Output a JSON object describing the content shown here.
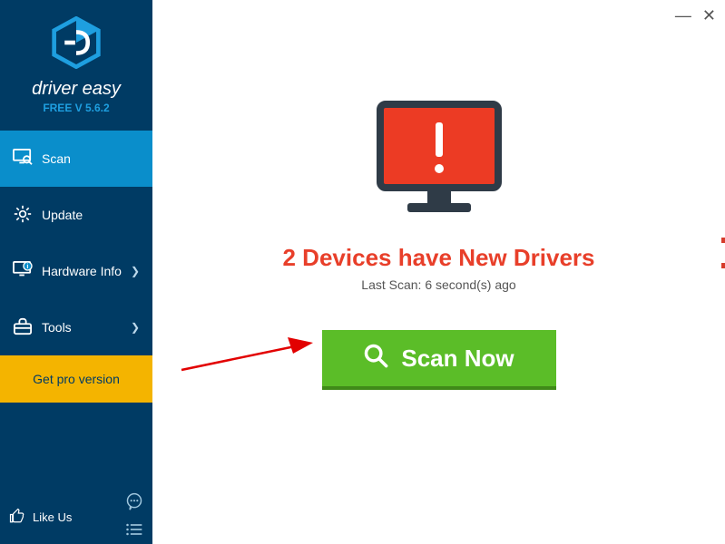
{
  "brand": {
    "name": "driver easy",
    "version": "FREE V 5.6.2"
  },
  "sidebar": {
    "items": [
      {
        "label": "Scan"
      },
      {
        "label": "Update"
      },
      {
        "label": "Hardware Info"
      },
      {
        "label": "Tools"
      }
    ],
    "pro_label": "Get pro version",
    "like_label": "Like Us"
  },
  "main": {
    "headline": "2 Devices have New Drivers",
    "last_scan": "Last Scan: 6 second(s) ago",
    "scan_button": "Scan Now"
  }
}
